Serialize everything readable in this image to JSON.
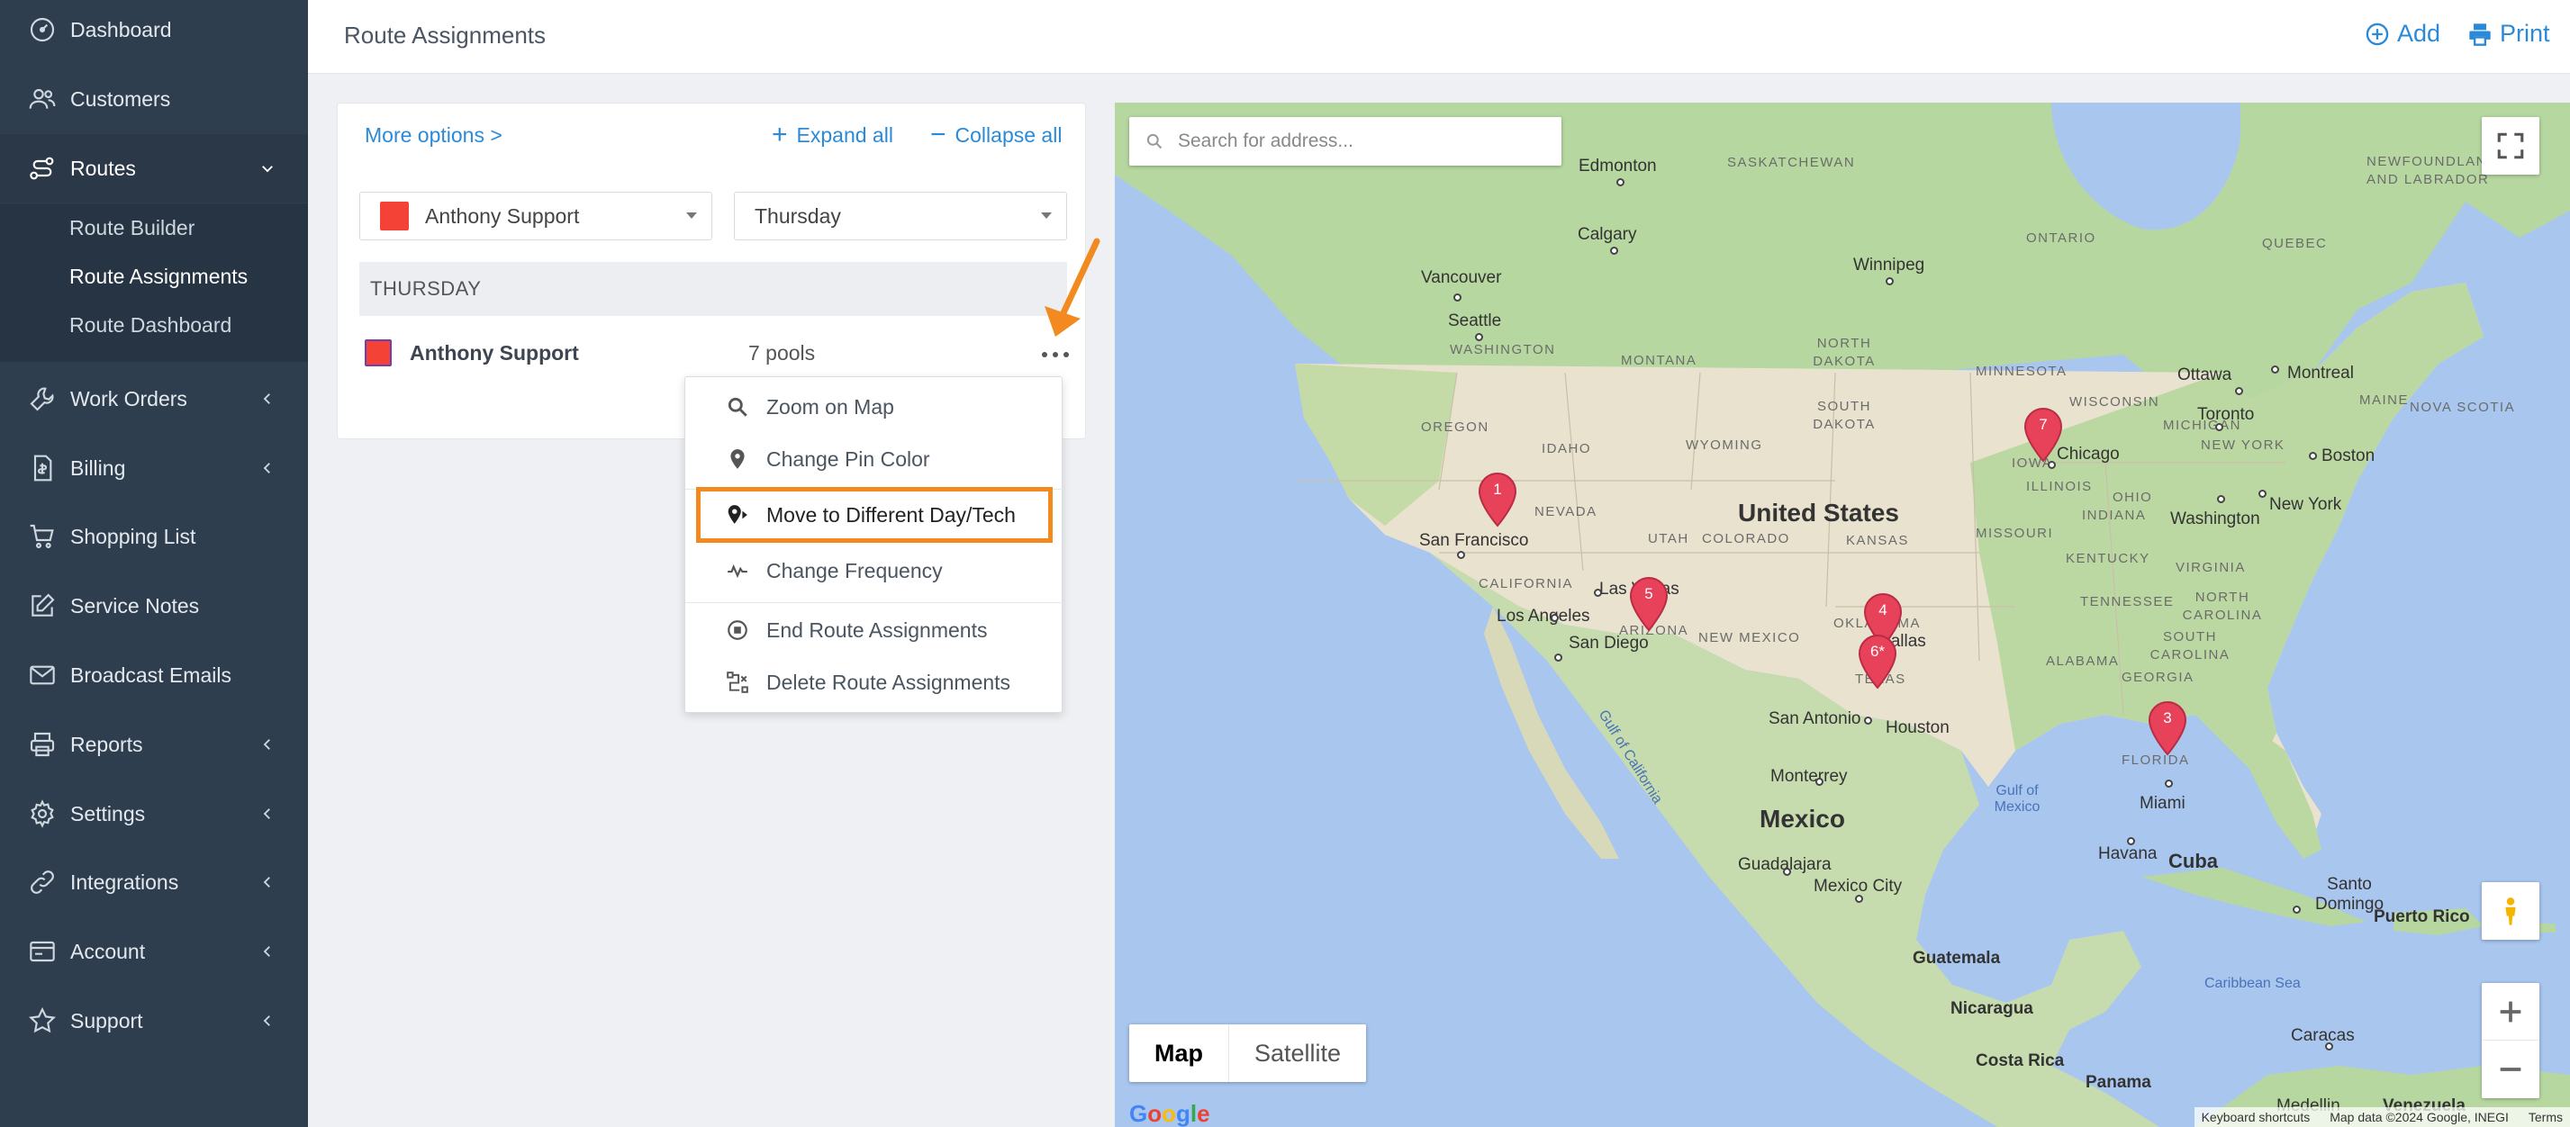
{
  "sidebar": {
    "items": [
      {
        "label": "Dashboard",
        "icon": "dashboard-icon"
      },
      {
        "label": "Customers",
        "icon": "customers-icon"
      },
      {
        "label": "Routes",
        "icon": "routes-icon"
      },
      {
        "label": "Work Orders",
        "icon": "wrench-icon"
      },
      {
        "label": "Billing",
        "icon": "billing-icon"
      },
      {
        "label": "Shopping List",
        "icon": "cart-icon"
      },
      {
        "label": "Service Notes",
        "icon": "edit-icon"
      },
      {
        "label": "Broadcast Emails",
        "icon": "mail-icon"
      },
      {
        "label": "Reports",
        "icon": "printer-icon"
      },
      {
        "label": "Settings",
        "icon": "gear-icon"
      },
      {
        "label": "Integrations",
        "icon": "link-icon"
      },
      {
        "label": "Account",
        "icon": "account-icon"
      },
      {
        "label": "Support",
        "icon": "star-icon"
      }
    ],
    "routes_submenu": [
      "Route Builder",
      "Route Assignments",
      "Route Dashboard"
    ]
  },
  "header": {
    "title": "Route Assignments",
    "add_label": "Add",
    "print_label": "Print"
  },
  "panel": {
    "more_options": "More options >",
    "expand_all": "Expand all",
    "collapse_all": "Collapse all",
    "tech_select": "Anthony Support",
    "day_select": "Thursday",
    "day_header": "THURSDAY",
    "route": {
      "name": "Anthony Support",
      "count": "7 pools"
    }
  },
  "menu": {
    "items": [
      "Zoom on Map",
      "Change Pin Color",
      "Move to Different Day/Tech",
      "Change Frequency",
      "End Route Assignments",
      "Delete Route Assignments"
    ]
  },
  "map": {
    "search_placeholder": "Search for address...",
    "type_map": "Map",
    "type_satellite": "Satellite",
    "google": "Google",
    "attribution": {
      "shortcuts": "Keyboard shortcuts",
      "data": "Map data ©2024 Google, INEGI",
      "terms": "Terms"
    },
    "pins": [
      {
        "label": "1"
      },
      {
        "label": "5"
      },
      {
        "label": "4"
      },
      {
        "label": "6*"
      },
      {
        "label": "7"
      },
      {
        "label": "3"
      }
    ],
    "labels": {
      "edmonton": "Edmonton",
      "saskatchewan": "SASKATCHEWAN",
      "calgary": "Calgary",
      "ontario": "ONTARIO",
      "quebec": "QUEBEC",
      "newfoundland": "NEWFOUNDLAND AND LABRADOR",
      "winnipeg": "Winnipeg",
      "vancouver": "Vancouver",
      "seattle": "Seattle",
      "washington_state": "WASHINGTON",
      "montana": "MONTANA",
      "north_dakota": "NORTH DAKOTA",
      "south_dakota": "SOUTH DAKOTA",
      "minnesota": "MINNESOTA",
      "wisconsin": "WISCONSIN",
      "michigan": "MICHIGAN",
      "ottawa": "Ottawa",
      "montreal": "Montreal",
      "maine": "MAINE",
      "nova_scotia": "NOVA SCOTIA",
      "toronto": "Toronto",
      "new_york_state": "NEW YORK",
      "boston": "Boston",
      "oregon": "OREGON",
      "idaho": "IDAHO",
      "wyoming": "WYOMING",
      "iowa": "IOWA",
      "chicago": "Chicago",
      "ohio": "OHIO",
      "illinois": "ILLINOIS",
      "indiana": "INDIANA",
      "nevada": "NEVADA",
      "united_states": "United States",
      "washington_dc": "Washington",
      "new_york_city": "New York",
      "san_francisco": "San Francisco",
      "utah": "UTAH",
      "colorado": "COLORADO",
      "kansas": "KANSAS",
      "missouri": "MISSOURI",
      "kentucky": "KENTUCKY",
      "virginia": "VIRGINIA",
      "california": "CALIFORNIA",
      "las_vegas": "Las Vegas",
      "tennessee": "TENNESSEE",
      "north_carolina": "NORTH CAROLINA",
      "los_angeles": "Los Angeles",
      "arizona": "ARIZONA",
      "oklahoma": "OKLAHOMA",
      "south_carolina": "SOUTH CAROLINA",
      "dallas": "Dallas",
      "san_diego": "San Diego",
      "new_mexico": "NEW MEXICO",
      "alabama": "ALABAMA",
      "georgia": "GEORGIA",
      "texas": "TEXAS",
      "gulf_of_california": "Gulf of California",
      "san_antonio": "San Antonio",
      "houston": "Houston",
      "florida": "FLORIDA",
      "monterrey": "Monterrey",
      "gulf_of_mexico": "Gulf of Mexico",
      "miami": "Miami",
      "mexico": "Mexico",
      "havana": "Havana",
      "cuba": "Cuba",
      "guadalajara": "Guadalajara",
      "mexico_city": "Mexico City",
      "santo_domingo": "Santo Domingo",
      "puerto_rico": "Puerto Rico",
      "caribbean_sea": "Caribbean Sea",
      "guatemala": "Guatemala",
      "nicaragua": "Nicaragua",
      "caracas": "Caracas",
      "costa_rica": "Costa Rica",
      "panama": "Panama",
      "medellin": "Medellin",
      "venezuela": "Venezuela"
    }
  },
  "colors": {
    "sidebar_bg": "#2f3e4e",
    "accent": "#2b8ad8",
    "highlight": "#f28a1f",
    "pin": "#e8425a",
    "route_swatch": "#f44336"
  }
}
